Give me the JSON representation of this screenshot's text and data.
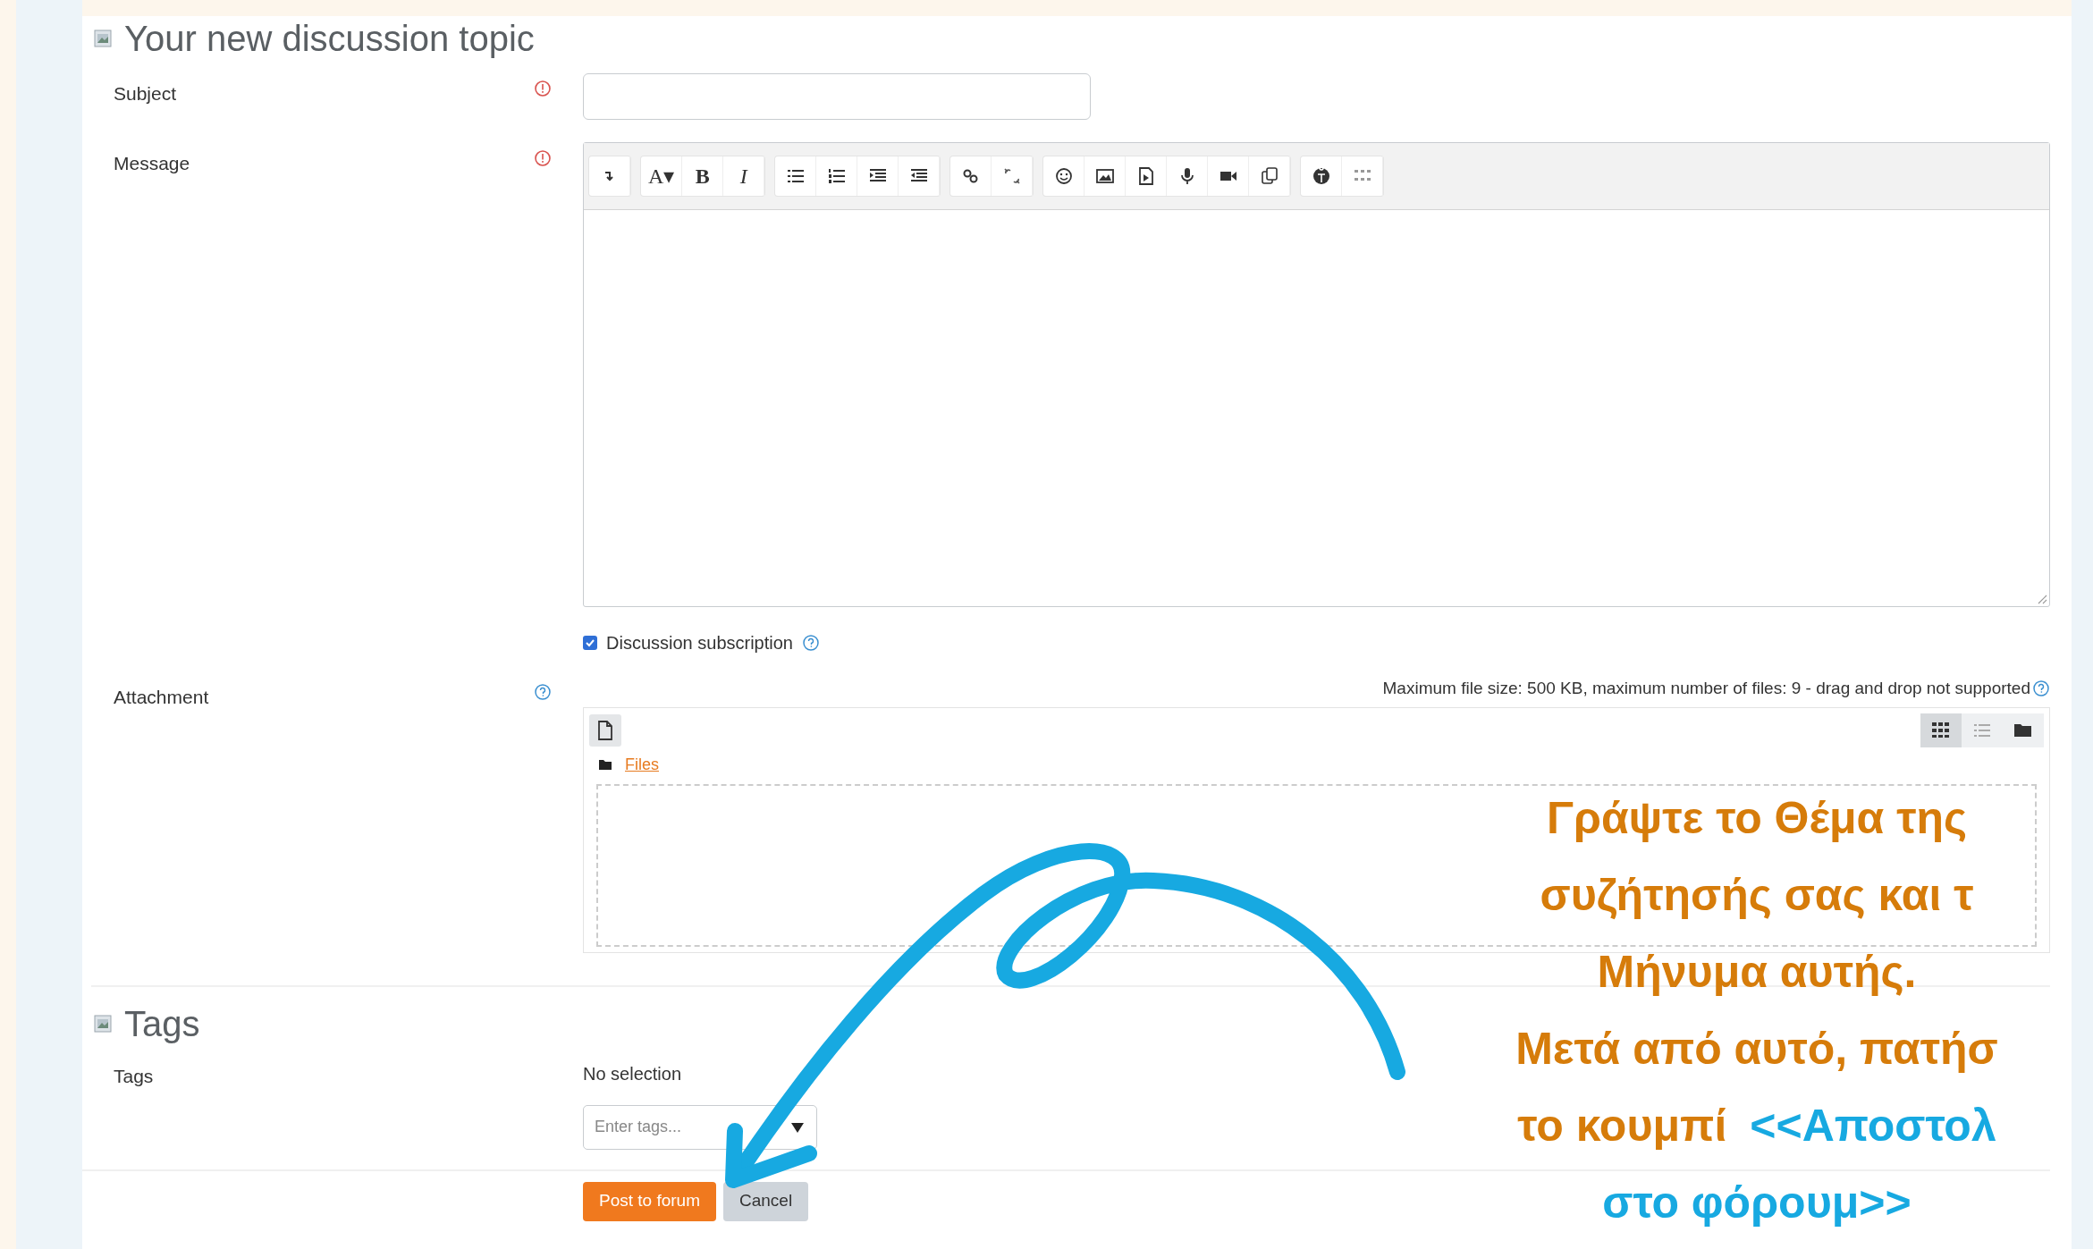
{
  "sections": [
    {
      "title": "Your new discussion topic"
    },
    {
      "title": "Tags"
    }
  ],
  "subject": {
    "label": "Subject",
    "required": true
  },
  "message": {
    "label": "Message",
    "required": true,
    "toolbar": [
      [
        {
          "kind": "collapse"
        }
      ],
      [
        {
          "kind": "text",
          "label": "A▾"
        },
        {
          "kind": "bold",
          "label": "B"
        },
        {
          "kind": "italic",
          "label": "I"
        }
      ],
      [
        {
          "kind": "bullets"
        },
        {
          "kind": "numbers"
        },
        {
          "kind": "indent"
        },
        {
          "kind": "outdent"
        }
      ],
      [
        {
          "kind": "link"
        },
        {
          "kind": "unlink"
        }
      ],
      [
        {
          "kind": "emoji"
        },
        {
          "kind": "image"
        },
        {
          "kind": "media"
        },
        {
          "kind": "mic"
        },
        {
          "kind": "video"
        },
        {
          "kind": "files"
        }
      ],
      [
        {
          "kind": "globe"
        },
        {
          "kind": "grid"
        }
      ]
    ]
  },
  "subscription": {
    "label": "Discussion subscription",
    "checked": true
  },
  "attachment": {
    "label": "Attachment",
    "limits": "Maximum file size: 500 KB, maximum number of files: 9 - drag and drop not supported",
    "folder": "Files",
    "view_modes": [
      {
        "kind": "icons",
        "selected": true
      },
      {
        "kind": "list",
        "selected": false
      },
      {
        "kind": "tree",
        "selected": false
      }
    ]
  },
  "tags": {
    "label": "Tags",
    "selection": "No selection",
    "placeholder": "Enter tags..."
  },
  "buttons": [
    {
      "label": "Post to forum",
      "kind": "primary"
    },
    {
      "label": "Cancel",
      "kind": "secondary"
    }
  ],
  "annotation": {
    "lines": [
      [
        {
          "text": "Γράψτε το Θέμα της",
          "color": "#d67c0a"
        }
      ],
      [
        {
          "text": "συζήτησής σας και τ",
          "color": "#d67c0a"
        }
      ],
      [
        {
          "text": "Μήνυμα αυτής.",
          "color": "#d67c0a"
        }
      ],
      [
        {
          "text": "Μετά από αυτό, πατήσ",
          "color": "#d67c0a"
        }
      ],
      [
        {
          "text": "το κουμπί",
          "color": "#d67c0a"
        },
        {
          "text": "<<Αποστολ",
          "color": "#17a9e1"
        }
      ],
      [
        {
          "text": "στο φόρουμ>>",
          "color": "#17a9e1"
        }
      ]
    ]
  }
}
